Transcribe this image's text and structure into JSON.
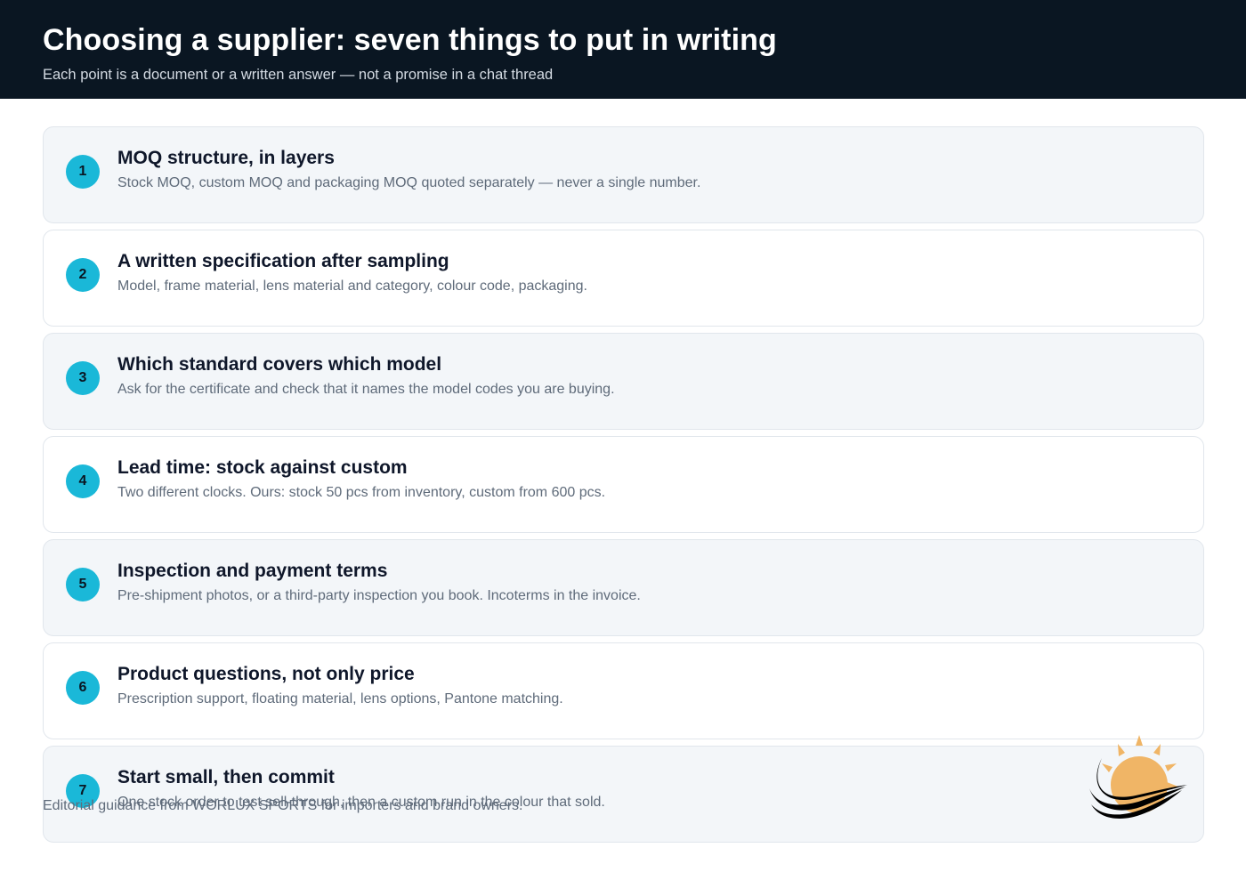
{
  "header": {
    "title": "Choosing a supplier: seven things to put in writing",
    "subtitle": "Each point is a document or a written answer — not a promise in a chat thread"
  },
  "items": [
    {
      "number": "1",
      "title": "MOQ structure, in layers",
      "description": "Stock MOQ, custom MOQ and packaging MOQ quoted separately — never a single number."
    },
    {
      "number": "2",
      "title": "A written specification after sampling",
      "description": "Model, frame material, lens material and category, colour code, packaging."
    },
    {
      "number": "3",
      "title": "Which standard covers which model",
      "description": "Ask for the certificate and check that it names the model codes you are buying."
    },
    {
      "number": "4",
      "title": "Lead time: stock against custom",
      "description": "Two different clocks. Ours: stock 50 pcs from inventory, custom from 600 pcs."
    },
    {
      "number": "5",
      "title": "Inspection and payment terms",
      "description": "Pre-shipment photos, or a third-party inspection you book. Incoterms in the invoice."
    },
    {
      "number": "6",
      "title": "Product questions, not only price",
      "description": "Prescription support, floating material, lens options, Pantone matching."
    },
    {
      "number": "7",
      "title": "Start small, then commit",
      "description": "One stock order to test sell-through, then a custom run in the colour that sold."
    }
  ],
  "footer": {
    "text": "Editorial guidance from WORLUX SPORTS for importers and brand owners."
  },
  "colors": {
    "header_bg": "#0a1622",
    "badge": "#1ab8d8",
    "card_alt_bg": "#f3f6f9",
    "logo_sun": "#f0b566",
    "logo_swoosh": "#000000"
  },
  "logo": {
    "icon": "sun-swoosh-logo-icon"
  }
}
